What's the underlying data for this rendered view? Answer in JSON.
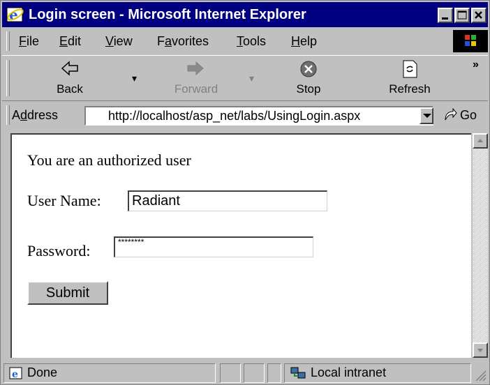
{
  "window": {
    "title": "Login screen - Microsoft Internet Explorer",
    "icon": "ie-icon",
    "controls": [
      "minimize-icon",
      "maximize-icon",
      "close-icon"
    ]
  },
  "menu": {
    "items": [
      {
        "label": "File",
        "accel": "F",
        "rest": "ile"
      },
      {
        "label": "Edit",
        "accel": "E",
        "rest": "dit"
      },
      {
        "label": "View",
        "accel": "V",
        "rest": "iew"
      },
      {
        "label": "Favorites",
        "pre": "F",
        "accel": "a",
        "rest": "vorites"
      },
      {
        "label": "Tools",
        "accel": "T",
        "rest": "ools"
      },
      {
        "label": "Help",
        "accel": "H",
        "rest": "elp"
      }
    ]
  },
  "toolbar": {
    "back": "Back",
    "forward": "Forward",
    "stop": "Stop",
    "refresh": "Refresh",
    "more": "»"
  },
  "address": {
    "label_accel": "d",
    "label_pre": "A",
    "label_rest": "dress",
    "url": "http://localhost/asp_net/labs/UsingLogin.aspx",
    "go": "Go"
  },
  "page": {
    "message": "You are an authorized user",
    "username_label": "User Name:",
    "username_value": "Radiant",
    "password_label": "Password:",
    "password_value": "********",
    "submit": "Submit"
  },
  "status": {
    "text": "Done",
    "zone": "Local intranet"
  },
  "colors": {
    "titlebar": "#000080",
    "chrome": "#c0c0c0",
    "content_bg": "#ffffff"
  }
}
